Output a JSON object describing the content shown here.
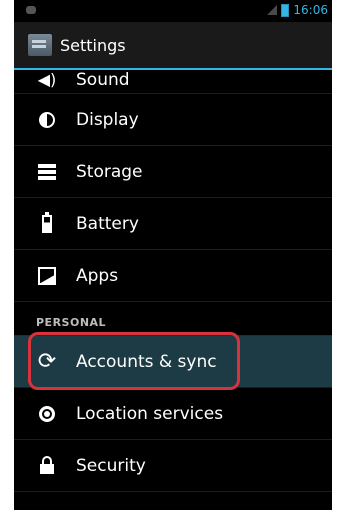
{
  "status_bar": {
    "time": "16:06"
  },
  "action_bar": {
    "title": "Settings"
  },
  "items": [
    {
      "label": "Sound",
      "icon": "sound-icon"
    },
    {
      "label": "Display",
      "icon": "display-icon"
    },
    {
      "label": "Storage",
      "icon": "storage-icon"
    },
    {
      "label": "Battery",
      "icon": "battery-icon"
    },
    {
      "label": "Apps",
      "icon": "apps-icon"
    }
  ],
  "section_personal": "PERSONAL",
  "personal_items": [
    {
      "label": "Accounts & sync",
      "icon": "sync-icon",
      "selected": true
    },
    {
      "label": "Location services",
      "icon": "location-icon"
    },
    {
      "label": "Security",
      "icon": "lock-icon"
    }
  ],
  "colors": {
    "accent": "#33b5e5",
    "highlight": "#d8323c",
    "selected_bg": "#1c3b45"
  }
}
